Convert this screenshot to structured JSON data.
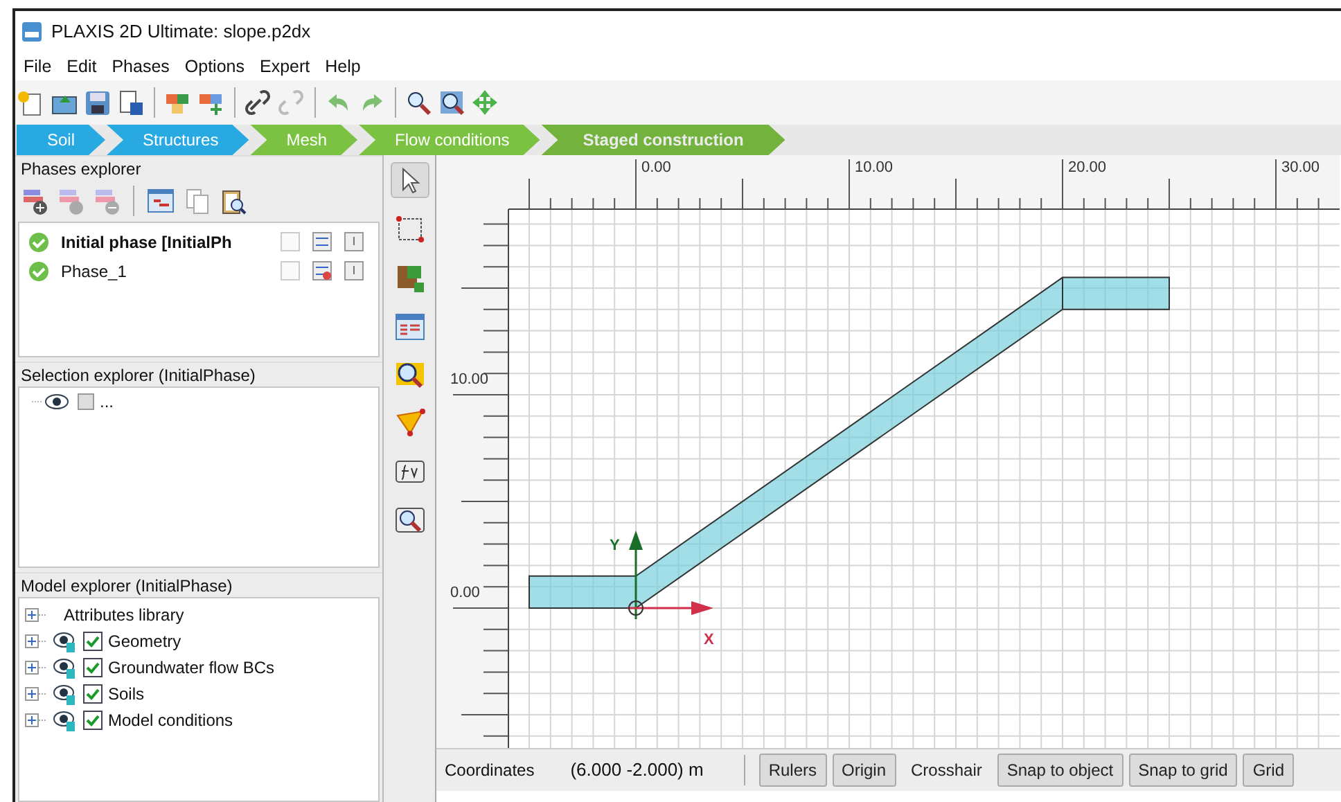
{
  "window": {
    "title": "PLAXIS 2D Ultimate: slope.p2dx"
  },
  "menu": [
    "File",
    "Edit",
    "Phases",
    "Options",
    "Expert",
    "Help"
  ],
  "modes": [
    {
      "label": "Soil",
      "color": "#29a9e1",
      "selected": false
    },
    {
      "label": "Structures",
      "color": "#29a9e1",
      "selected": false
    },
    {
      "label": "Mesh",
      "color": "#7cc242",
      "selected": false
    },
    {
      "label": "Flow conditions",
      "color": "#7cc242",
      "selected": false
    },
    {
      "label": "Staged construction",
      "color": "#7cc242",
      "selected": true
    }
  ],
  "phases_explorer": {
    "title": "Phases explorer",
    "phases": [
      {
        "name": "Initial phase [InitialPh",
        "selected": true
      },
      {
        "name": "Phase_1",
        "selected": false
      }
    ]
  },
  "selection_explorer": {
    "title": "Selection explorer (InitialPhase)",
    "items": [
      "..."
    ]
  },
  "model_explorer": {
    "title": "Model explorer (InitialPhase)",
    "items": [
      {
        "label": "Attributes library",
        "kind": "folder"
      },
      {
        "label": "Geometry",
        "kind": "layer",
        "checked": true
      },
      {
        "label": "Groundwater flow BCs",
        "kind": "layer",
        "checked": true
      },
      {
        "label": "Soils",
        "kind": "layer",
        "checked": true
      },
      {
        "label": "Model conditions",
        "kind": "layer",
        "checked": true
      }
    ]
  },
  "canvas": {
    "x_ruler_labels": [
      "0.00",
      "10.00",
      "20.00",
      "30.00"
    ],
    "y_ruler_labels": [
      "10.00",
      "0.00"
    ],
    "x_axis_label": "X",
    "y_axis_label": "Y"
  },
  "status_bar": {
    "label": "Coordinates",
    "value": "(6.000 -2.000) m",
    "toggles": [
      {
        "label": "Rulers",
        "on": true
      },
      {
        "label": "Origin",
        "on": true
      },
      {
        "label": "Crosshair",
        "on": false
      },
      {
        "label": "Snap to object",
        "on": true
      },
      {
        "label": "Snap to grid",
        "on": true
      },
      {
        "label": "Grid",
        "on": true
      }
    ]
  }
}
